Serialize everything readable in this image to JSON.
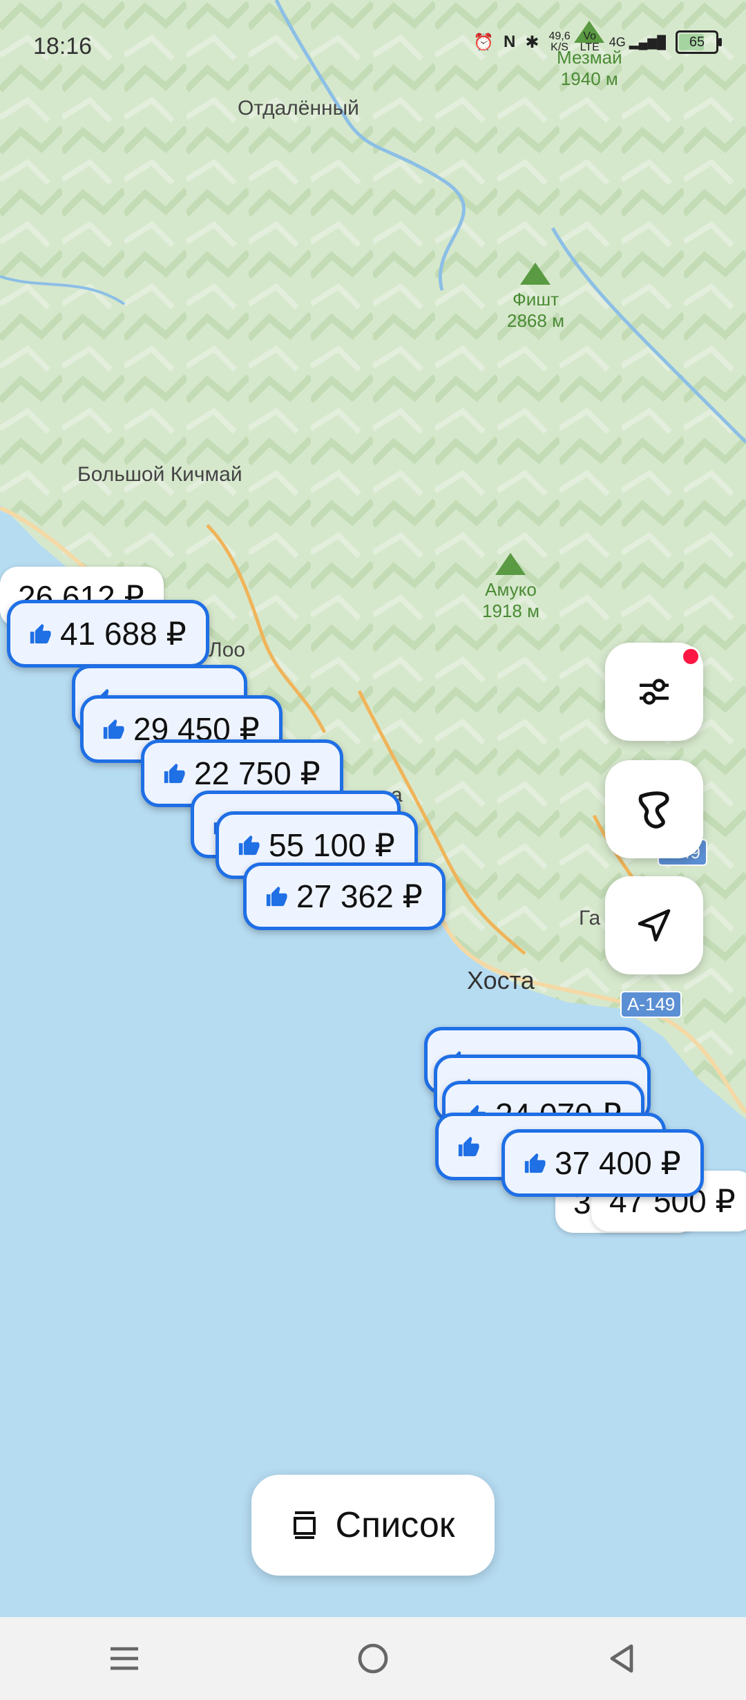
{
  "status": {
    "time": "18:16",
    "speed_top": "49,6",
    "speed_unit": "K/S",
    "net_top": "Vo",
    "net_bottom": "LTE",
    "net_gen": "4G",
    "battery": "65"
  },
  "map": {
    "places": [
      "Отдалённый",
      "Большой Кичмай",
      "Лоо",
      "Хоста",
      "Га",
      "а"
    ],
    "peaks": [
      {
        "name": "Мезмай",
        "height": "1940 м"
      },
      {
        "name": "Фишт",
        "height": "2868 м"
      },
      {
        "name": "Амуко",
        "height": "1918 м"
      }
    ],
    "road_signs": [
      "-149",
      "А-149"
    ]
  },
  "pins": [
    {
      "label": "26 612 ₽",
      "recommended": false
    },
    {
      "label": "41 688 ₽",
      "recommended": true
    },
    {
      "label": "",
      "recommended": true
    },
    {
      "label": "29 450 ₽",
      "recommended": true
    },
    {
      "label": "22 750 ₽",
      "recommended": true
    },
    {
      "label": "",
      "recommended": true
    },
    {
      "label": "55 100 ₽",
      "recommended": true
    },
    {
      "label": "27 362 ₽",
      "recommended": true
    },
    {
      "label": "",
      "recommended": true
    },
    {
      "label": "",
      "recommended": true
    },
    {
      "label": "24 070 ₽",
      "recommended": true
    },
    {
      "label": "",
      "recommended": true
    },
    {
      "label": "3",
      "recommended": false
    },
    {
      "label": "47 500 ₽",
      "recommended": false
    },
    {
      "label": "37 400 ₽",
      "recommended": true
    }
  ],
  "controls": {
    "filters": "filters-icon",
    "draw_area": "draw-area-icon",
    "location": "location-arrow-icon"
  },
  "list_button": {
    "label": "Список"
  },
  "colors": {
    "accent": "#1f6fe5",
    "badge": "#ff1744",
    "sea": "#b6dcf2",
    "land": "#dcebd3"
  }
}
